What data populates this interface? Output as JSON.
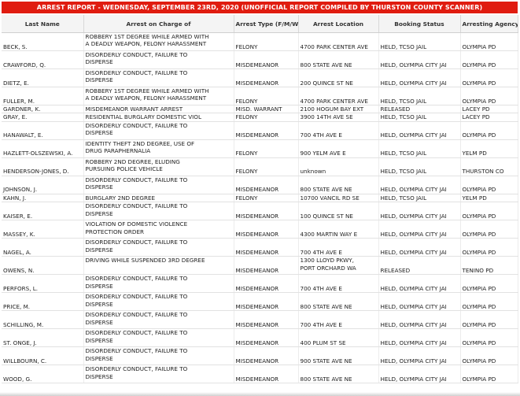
{
  "title": "ARREST REPORT - WEDNESDAY, SEPTEMBER 23RD, 2020 (UNOFFICIAL REPORT COMPILED BY THURSTON COUNTY SCANNER)",
  "columns": [
    "Last Name",
    "Arrest on Charge of",
    "Arrest Type (F/M/W)",
    "Arrest Location",
    "Booking Status",
    "Arresting Agency"
  ],
  "rows": [
    {
      "name": "BECK, S.",
      "charge": [
        "ROBBERY 1ST DEGREE WHILE ARMED WITH",
        "A DEADLY WEAPON, FELONY HARASSMENT"
      ],
      "type": "FELONY",
      "location": [
        "4700 PARK CENTER AVE"
      ],
      "status": "HELD, TCSO JAIL",
      "agency": "OLYMPIA PD"
    },
    {
      "name": "CRAWFORD, Q.",
      "charge": [
        "DISORDERLY CONDUCT, FAILURE TO",
        "DISPERSE"
      ],
      "type": "MISDEMEANOR",
      "location": [
        "800 STATE AVE NE"
      ],
      "status": "HELD, OLYMPIA CITY JAI",
      "agency": "OLYMPIA PD"
    },
    {
      "name": "DIETZ, E.",
      "charge": [
        "DISORDERLY CONDUCT, FAILURE TO",
        "DISPERSE"
      ],
      "type": "MISDEMEANOR",
      "location": [
        "200 QUINCE ST NE"
      ],
      "status": "HELD, OLYMPIA CITY JAI",
      "agency": "OLYMPIA PD"
    },
    {
      "name": "FULLER, M.",
      "charge": [
        "ROBBERY 1ST DEGREE WHILE ARMED WITH",
        "A DEADLY WEAPON, FELONY HARASSMENT"
      ],
      "type": "FELONY",
      "location": [
        "4700 PARK CENTER AVE"
      ],
      "status": "HELD, TCSO JAIL",
      "agency": "OLYMPIA PD"
    },
    {
      "name": "GARDNER, K.",
      "charge": [
        "MISDEMEANOR WARRANT ARREST"
      ],
      "type": "MISD. WARRANT",
      "location": [
        "2100 HOGUM BAY EXT"
      ],
      "status": "RELEASED",
      "agency": "LACEY PD"
    },
    {
      "name": "GRAY, E.",
      "charge": [
        "RESIDENTIAL BURGLARY DOMESTIC VIOL"
      ],
      "type": "FELONY",
      "location": [
        "3900 14TH AVE SE"
      ],
      "status": "HELD, TCSO JAIL",
      "agency": "LACEY PD"
    },
    {
      "name": "HANAWALT, E.",
      "charge": [
        "DISORDERLY CONDUCT, FAILURE TO",
        "DISPERSE"
      ],
      "type": "MISDEMEANOR",
      "location": [
        "700 4TH AVE E"
      ],
      "status": "HELD, OLYMPIA CITY JAI",
      "agency": "OLYMPIA PD"
    },
    {
      "name": "HAZLETT-OLSZEWSKI, A.",
      "charge": [
        "IDENTITY THEFT 2ND DEGREE, USE OF",
        "DRUG PARAPHERNALIA"
      ],
      "type": "FELONY",
      "location": [
        "900 YELM AVE E"
      ],
      "status": "HELD, TCSO JAIL",
      "agency": "YELM PD"
    },
    {
      "name": "HENDERSON-JONES, D.",
      "charge": [
        "ROBBERY 2ND DEGREE, ELUDING",
        "PURSUING POLICE VEHICLE"
      ],
      "type": "FELONY",
      "location": [
        "unknown"
      ],
      "status": "HELD, TCSO JAIL",
      "agency": "THURSTON CO"
    },
    {
      "name": "JOHNSON, J.",
      "charge": [
        "DISORDERLY CONDUCT, FAILURE TO",
        "DISPERSE"
      ],
      "type": "MISDEMEANOR",
      "location": [
        "800 STATE AVE NE"
      ],
      "status": "HELD, OLYMPIA CITY JAI",
      "agency": "OLYMPIA PD"
    },
    {
      "name": "KAHN, J.",
      "charge": [
        "BURGLARY 2ND DEGREE"
      ],
      "type": "FELONY",
      "location": [
        "10700 VANCIL RD SE"
      ],
      "status": "HELD, TCSO JAIL",
      "agency": "YELM PD"
    },
    {
      "name": "KAISER, E.",
      "charge": [
        "DISORDERLY CONDUCT, FAILURE TO",
        "DISPERSE"
      ],
      "type": "MISDEMEANOR",
      "location": [
        "100 QUINCE ST NE"
      ],
      "status": "HELD, OLYMPIA CITY JAI",
      "agency": "OLYMPIA PD"
    },
    {
      "name": "MASSEY, K.",
      "charge": [
        "VIOLATION OF DOMESTIC VIOLENCE",
        "PROTECTION ORDER"
      ],
      "type": "MISDEMEANOR",
      "location": [
        "4300 MARTIN WAY E"
      ],
      "status": "HELD, OLYMPIA CITY JAI",
      "agency": "OLYMPIA PD"
    },
    {
      "name": "NAGEL, A.",
      "charge": [
        "DISORDERLY CONDUCT, FAILURE TO",
        "DISPERSE"
      ],
      "type": "MISDEMEANOR",
      "location": [
        "700 4TH AVE E"
      ],
      "status": "HELD, OLYMPIA CITY JAI",
      "agency": "OLYMPIA PD"
    },
    {
      "name": "OWENS, N.",
      "charge": [
        "DRIVING WHILE SUSPENDED 3RD DEGREE"
      ],
      "type": "MISDEMEANOR",
      "location": [
        "1300 LLOYD PKWY,",
        "PORT ORCHARD WA"
      ],
      "status": "RELEASED",
      "agency": "TENINO PD"
    },
    {
      "name": "PERFORS, L.",
      "charge": [
        "DISORDERLY CONDUCT, FAILURE TO",
        "DISPERSE"
      ],
      "type": "MISDEMEANOR",
      "location": [
        "700 4TH AVE E"
      ],
      "status": "HELD, OLYMPIA CITY JAI",
      "agency": "OLYMPIA PD"
    },
    {
      "name": "PRICE, M.",
      "charge": [
        "DISORDERLY CONDUCT, FAILURE TO",
        "DISPERSE"
      ],
      "type": "MISDEMEANOR",
      "location": [
        "800 STATE AVE NE"
      ],
      "status": "HELD, OLYMPIA CITY JAI",
      "agency": "OLYMPIA PD"
    },
    {
      "name": "SCHILLING, M.",
      "charge": [
        "DISORDERLY CONDUCT, FAILURE TO",
        "DISPERSE"
      ],
      "type": "MISDEMEANOR",
      "location": [
        "700 4TH AVE E"
      ],
      "status": "HELD, OLYMPIA CITY JAI",
      "agency": "OLYMPIA PD"
    },
    {
      "name": "ST. ONGE, J.",
      "charge": [
        "DISORDERLY CONDUCT, FAILURE TO",
        "DISPERSE"
      ],
      "type": "MISDEMEANOR",
      "location": [
        "400 PLUM ST SE"
      ],
      "status": "HELD, OLYMPIA CITY JAI",
      "agency": "OLYMPIA PD"
    },
    {
      "name": "WILLBOURN, C.",
      "charge": [
        "DISORDERLY CONDUCT, FAILURE TO",
        "DISPERSE"
      ],
      "type": "MISDEMEANOR",
      "location": [
        "900 STATE AVE NE"
      ],
      "status": "HELD, OLYMPIA CITY JAI",
      "agency": "OLYMPIA PD"
    },
    {
      "name": "WOOD, G.",
      "charge": [
        "DISORDERLY CONDUCT, FAILURE TO",
        "DISPERSE"
      ],
      "type": "MISDEMEANOR",
      "location": [
        "800 STATE AVE NE"
      ],
      "status": "HELD, OLYMPIA CITY JAI",
      "agency": "OLYMPIA PD"
    }
  ]
}
